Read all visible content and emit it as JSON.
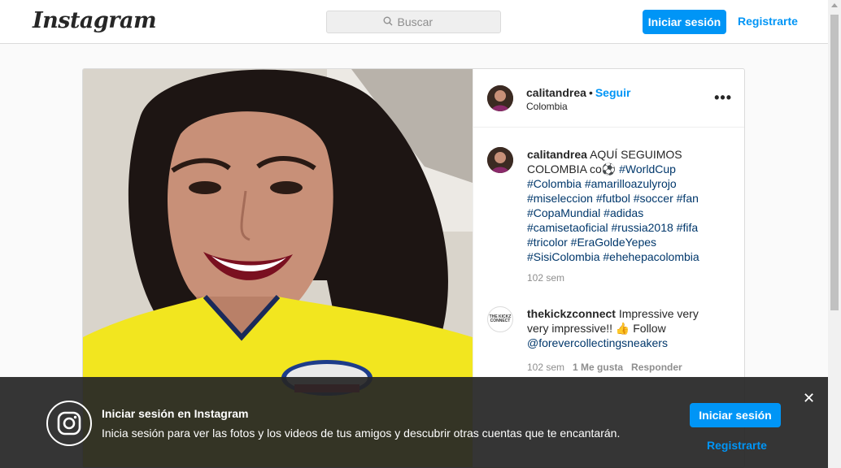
{
  "header": {
    "logo": "Instagram",
    "search_placeholder": "Buscar",
    "login_label": "Iniciar sesión",
    "register_label": "Registrarte"
  },
  "post": {
    "username": "calitandrea",
    "separator": "•",
    "follow_label": "Seguir",
    "location": "Colombia",
    "more_icon": "•••",
    "caption": {
      "username": "calitandrea",
      "text": "AQUÍ SEGUIMOS COLOMBIA co⚽",
      "hashtags": "#WorldCup #Colombia #amarilloazulyrojo #miseleccion #futbol #soccer #fan #CopaMundial #adidas #camisetaoficial #russia2018 #fifa #tricolor #EraGoldeYepes #SisiColombia #ehehepacolombia",
      "time": "102 sem"
    },
    "comment": {
      "username": "thekickzconnect",
      "text": "Impressive very very impressive!! 👍 Follow",
      "mention": "@forevercollectingsneakers",
      "time": "102 sem",
      "likes": "1 Me gusta",
      "reply": "Responder",
      "avatar_text": "THE KICKZ CONNECT"
    }
  },
  "banner": {
    "title": "Iniciar sesión en Instagram",
    "text": "Inicia sesión para ver las fotos y los videos de tus amigos y descubrir otras cuentas que te encantarán.",
    "login_label": "Iniciar sesión",
    "register_label": "Registrarte",
    "close_icon": "✕"
  },
  "colors": {
    "accent": "#0095f6",
    "jersey": "#f2e61f",
    "banner_bg": "#262626"
  }
}
